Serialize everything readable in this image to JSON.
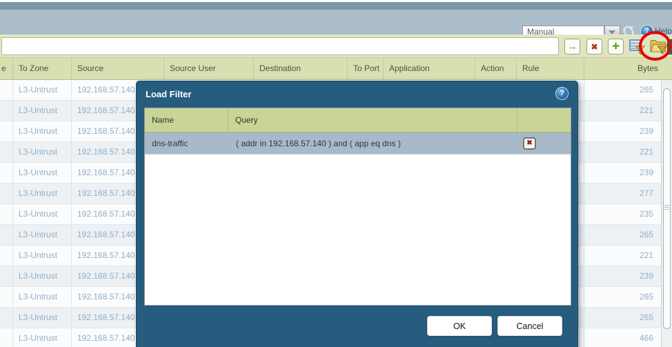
{
  "top_bar": {
    "refresh_mode": {
      "value": "Manual"
    },
    "refresh_icon": "refresh-icon",
    "help_icon": "help-icon",
    "help_label": "Help",
    "help_glyph": "?"
  },
  "filter_toolbar": {
    "input_value": "",
    "buttons": [
      {
        "name": "apply-filter-button",
        "icon": "arrow-right-icon"
      },
      {
        "name": "clear-filter-button",
        "icon": "red-x-icon"
      },
      {
        "name": "add-filter-button",
        "icon": "plus-icon"
      },
      {
        "name": "save-filter-button",
        "icon": "filter-disk-icon"
      },
      {
        "name": "load-filter-button",
        "icon": "folder-filter-icon",
        "highlighted": true
      },
      {
        "name": "export-button",
        "icon": "spreadsheet-icon"
      }
    ],
    "annotation": {
      "type": "red-circle",
      "target": "load-filter-button",
      "color": "#e40505"
    }
  },
  "log_table": {
    "columns": [
      "e",
      "To Zone",
      "Source",
      "Source User",
      "Destination",
      "To Port",
      "Application",
      "Action",
      "Rule",
      "Bytes"
    ],
    "rows": [
      {
        "to_zone": "L3-Untrust",
        "source": "192.168.57.140",
        "bytes": "265"
      },
      {
        "to_zone": "L3-Untrust",
        "source": "192.168.57.140",
        "bytes": "221"
      },
      {
        "to_zone": "L3-Untrust",
        "source": "192.168.57.140",
        "bytes": "239"
      },
      {
        "to_zone": "L3-Untrust",
        "source": "192.168.57.140",
        "bytes": "221"
      },
      {
        "to_zone": "L3-Untrust",
        "source": "192.168.57.140",
        "bytes": "239"
      },
      {
        "to_zone": "L3-Untrust",
        "source": "192.168.57.140",
        "bytes": "277"
      },
      {
        "to_zone": "L3-Untrust",
        "source": "192.168.57.140",
        "bytes": "235"
      },
      {
        "to_zone": "L3-Untrust",
        "source": "192.168.57.140",
        "bytes": "265"
      },
      {
        "to_zone": "L3-Untrust",
        "source": "192.168.57.140",
        "bytes": "221"
      },
      {
        "to_zone": "L3-Untrust",
        "source": "192.168.57.140",
        "bytes": "239"
      },
      {
        "to_zone": "L3-Untrust",
        "source": "192.168.57.140",
        "bytes": "265"
      },
      {
        "to_zone": "L3-Untrust",
        "source": "192.168.57.140",
        "bytes": "265"
      },
      {
        "to_zone": "L3-Untrust",
        "source": "192.168.57.140",
        "bytes": "466"
      }
    ]
  },
  "load_filter_dialog": {
    "title": "Load Filter",
    "help_glyph": "?",
    "columns": [
      "Name",
      "Query",
      ""
    ],
    "filters": [
      {
        "name": "dns-traffic",
        "query": "( addr in 192.168.57.140 ) and ( app eq dns )"
      }
    ],
    "delete_glyph": "✖",
    "ok_label": "OK",
    "cancel_label": "Cancel"
  },
  "colors": {
    "dialog_teal": "#265d7e",
    "header_khaki": "#dadfb2",
    "dialog_header_khaki": "#c9d597",
    "selected_row": "#a8b9c8",
    "row_link_text": "#92aec6",
    "annotation_red": "#e40505"
  }
}
